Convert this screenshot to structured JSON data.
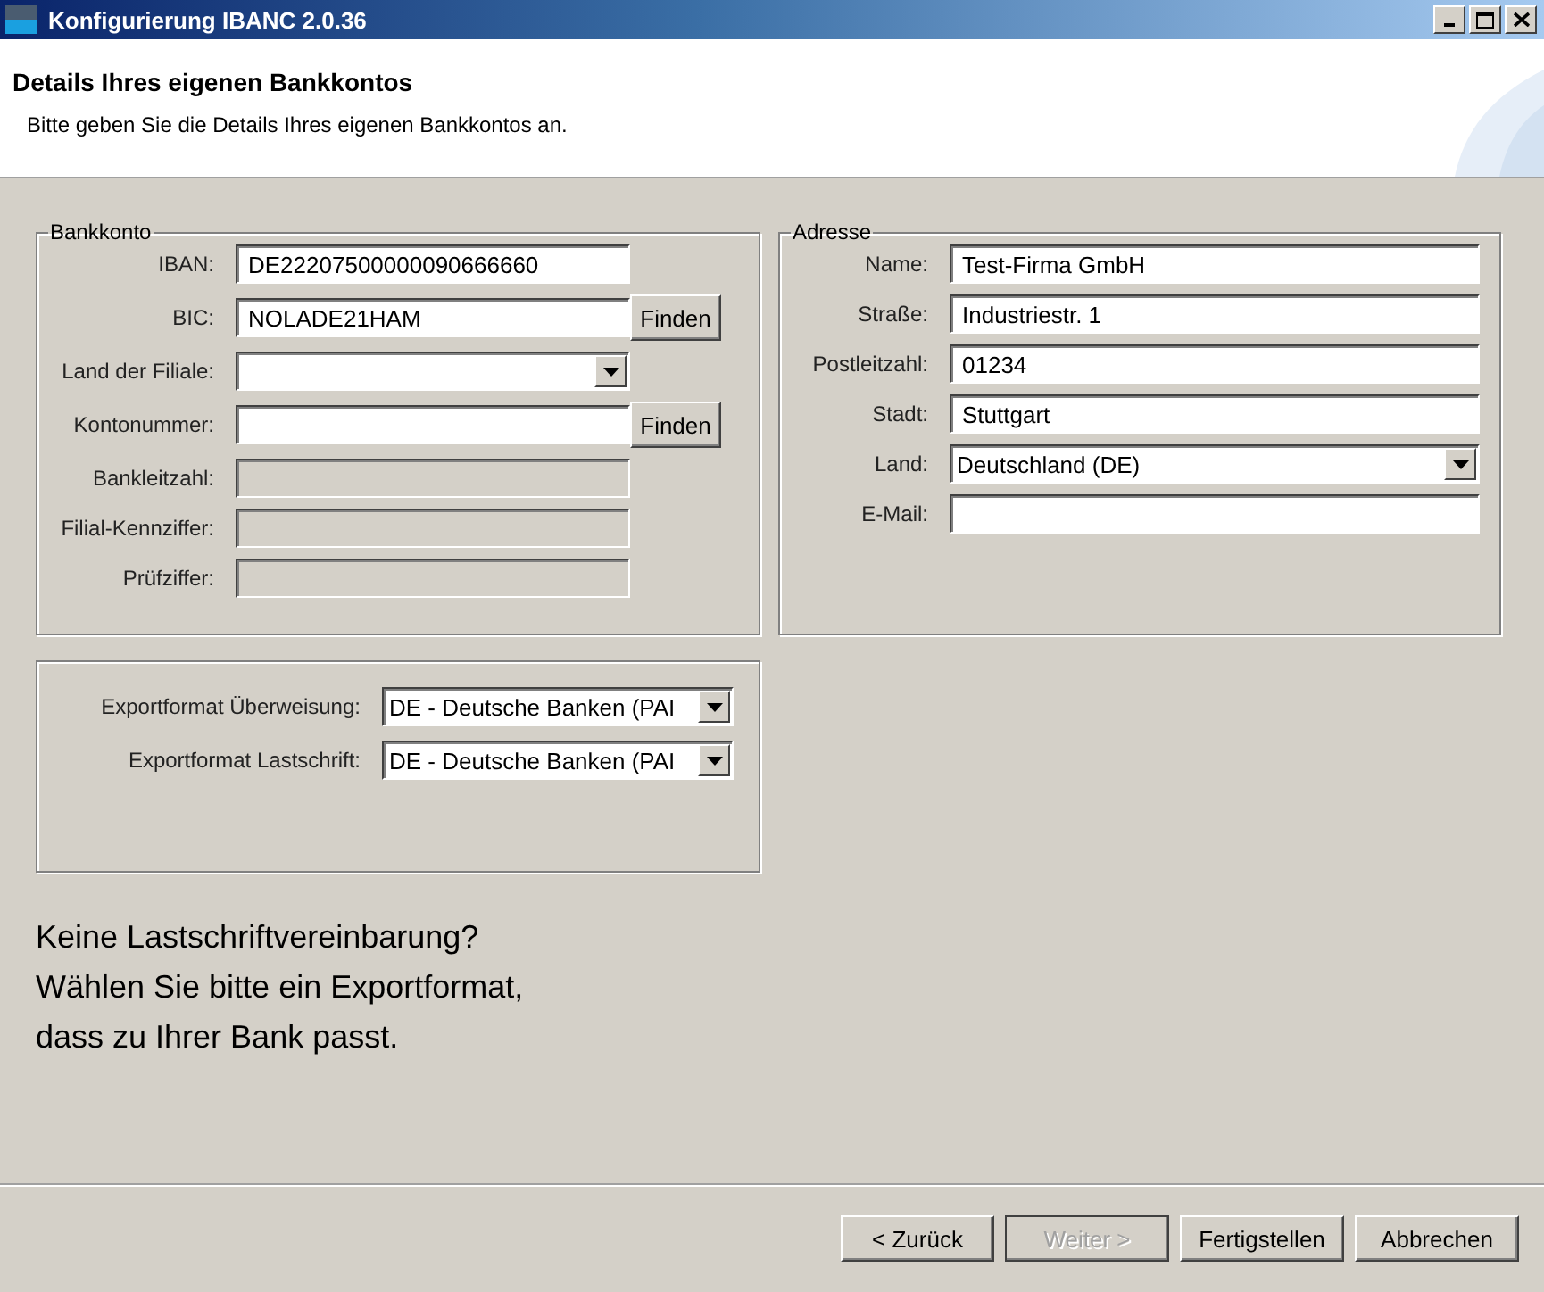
{
  "window": {
    "title": "Konfigurierung IBANC 2.0.36"
  },
  "header": {
    "title": "Details Ihres eigenen Bankkontos",
    "subtitle": "Bitte geben Sie die Details Ihres eigenen Bankkontos an."
  },
  "bank_account": {
    "title": "Bankkonto",
    "fields": [
      {
        "label": "IBAN:",
        "kind": "text",
        "value": "DE22207500000090666660"
      },
      {
        "label": "BIC:",
        "kind": "text",
        "value": "NOLADE21HAM",
        "button": "Finden"
      },
      {
        "label": "Land der Filiale:",
        "kind": "select"
      },
      {
        "label": "Kontonummer:",
        "kind": "text",
        "button": "Finden"
      },
      {
        "label": "Bankleitzahl:",
        "kind": "readonly"
      },
      {
        "label": "Filial-Kennziffer:",
        "kind": "readonly"
      },
      {
        "label": "Prüfziffer:",
        "kind": "readonly"
      }
    ]
  },
  "address": {
    "title": "Adresse",
    "fields": [
      {
        "label": "Name:",
        "kind": "text",
        "value": "Test-Firma GmbH"
      },
      {
        "label": "Straße:",
        "kind": "text",
        "value": "Industriestr. 1"
      },
      {
        "label": "Postleitzahl:",
        "kind": "text",
        "value": "01234"
      },
      {
        "label": "Stadt:",
        "kind": "text",
        "value": "Stuttgart"
      },
      {
        "label": "Land:",
        "kind": "select",
        "value": "Deutschland (DE)"
      },
      {
        "label": "E-Mail:",
        "kind": "text"
      }
    ]
  },
  "export": {
    "fields": [
      {
        "label": "Exportformat Überweisung:",
        "kind": "select",
        "value": "DE - Deutsche Banken (PAI"
      },
      {
        "label": "Exportformat Lastschrift:",
        "kind": "select",
        "value": "DE - Deutsche Banken (PAI"
      }
    ]
  },
  "hint": [
    "Keine Lastschriftvereinbarung?",
    "Wählen Sie bitte ein Exportformat,",
    "dass zu Ihrer Bank passt."
  ],
  "buttons": [
    {
      "label": "< Zurück",
      "disabled": false
    },
    {
      "label": "Weiter >",
      "disabled": true
    },
    {
      "label": "Fertigstellen",
      "disabled": false
    },
    {
      "label": "Abbrechen",
      "disabled": false
    }
  ]
}
